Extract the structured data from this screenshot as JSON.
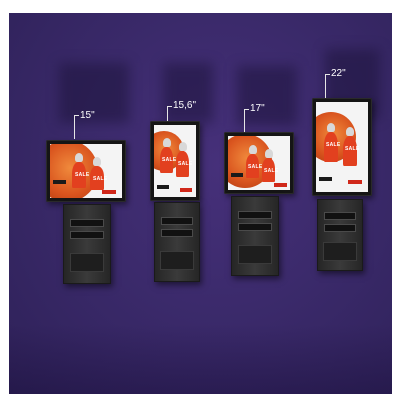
{
  "kiosks": [
    {
      "size_label": "15\"",
      "screen_text": "SALE"
    },
    {
      "size_label": "15,6\"",
      "screen_text": "SALE"
    },
    {
      "size_label": "17\"",
      "screen_text": "SALE"
    },
    {
      "size_label": "22\"",
      "screen_text": "SALE"
    }
  ],
  "colors": {
    "background": "#3b2a6b",
    "kiosk_body": "#2b2b2b",
    "screen_accent": "#e2401f",
    "label_text": "#ffffff"
  }
}
